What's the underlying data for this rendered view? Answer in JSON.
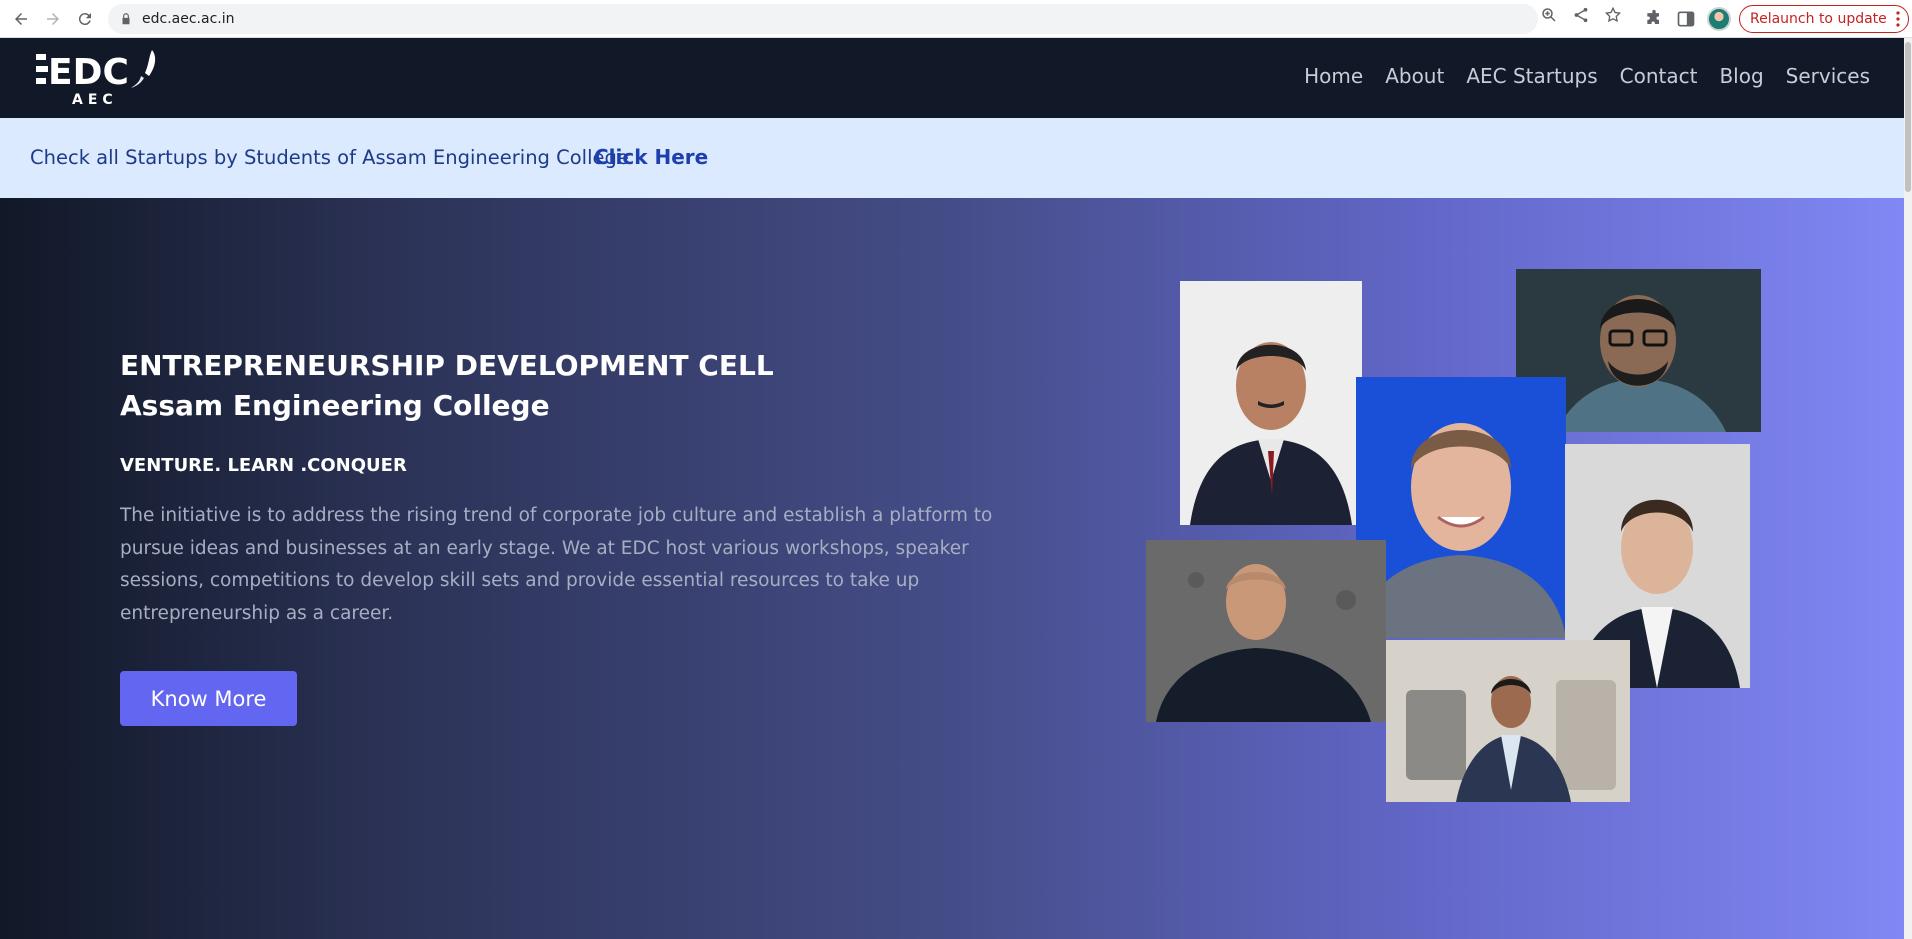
{
  "browser": {
    "url": "edc.aec.ac.in",
    "relaunch_label": "Relaunch to update"
  },
  "logo": {
    "wordmark": "EDC",
    "sub": "AEC"
  },
  "nav": {
    "items": [
      "Home",
      "About",
      "AEC Startups",
      "Contact",
      "Blog",
      "Services"
    ]
  },
  "announcement": {
    "text": "Check all Startups by Students of Assam Engineering College",
    "link_label": "Click Here"
  },
  "hero": {
    "title_line1": "ENTREPRENEURSHIP DEVELOPMENT CELL",
    "title_line2": "Assam Engineering College",
    "tagline": "VENTURE. LEARN .CONQUER",
    "description": "The initiative is to address the rising trend of corporate job culture and establish a platform to pursue ideas and businesses at an early stage. We at EDC host various workshops, speaker sessions, competitions to develop skill sets and provide essential resources to take up entrepreneurship as a career.",
    "cta_label": "Know More"
  },
  "colors": {
    "header_bg": "#111827",
    "announce_bg": "#dbeafe",
    "accent": "#6366f1",
    "gradient_end": "#8187f4"
  }
}
